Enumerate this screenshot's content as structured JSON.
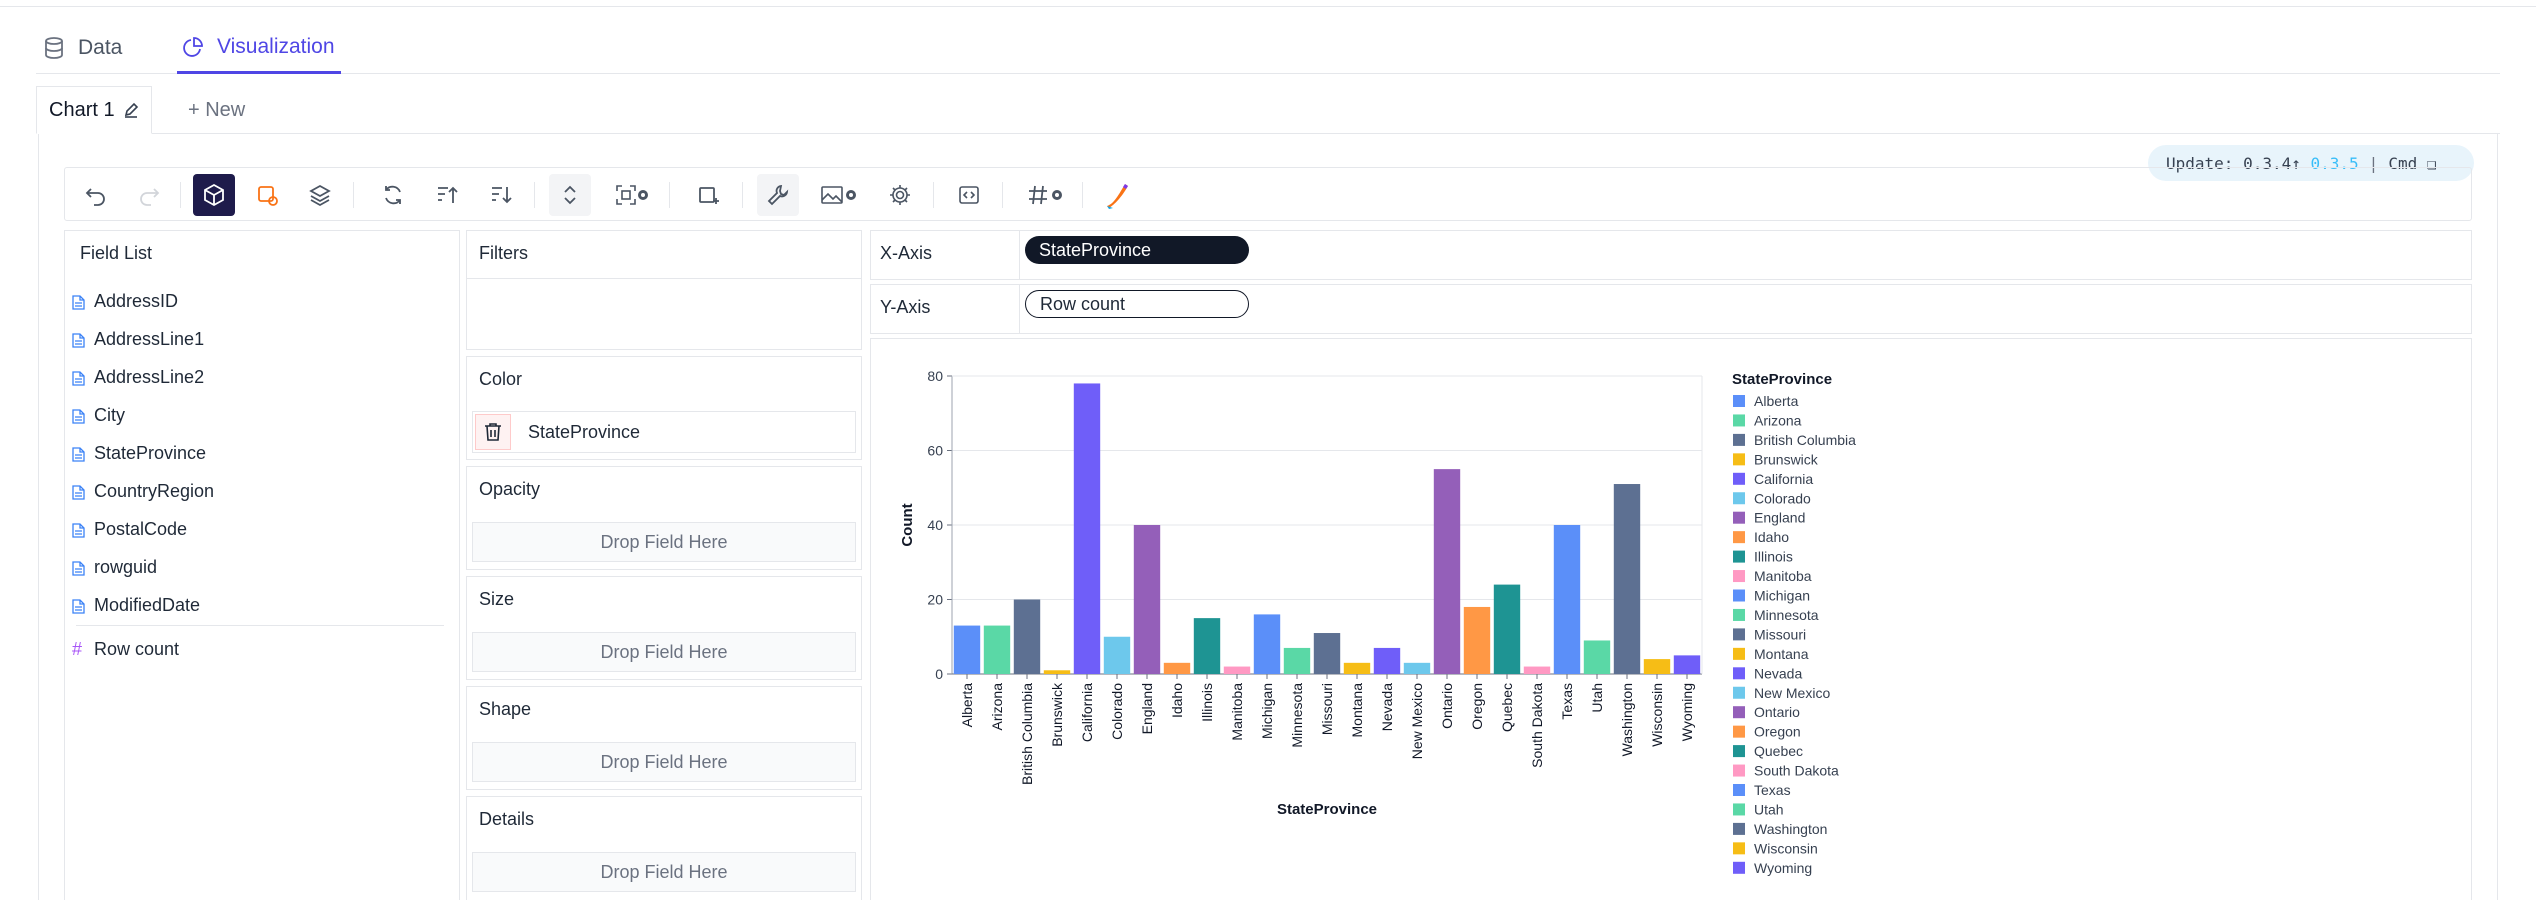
{
  "tabs": {
    "data": "Data",
    "visualization": "Visualization"
  },
  "chart_tabs": {
    "active": "Chart 1",
    "new": "+ New"
  },
  "update_badge": {
    "text": "Update: 0.3.4↑",
    "version": "0.3.5",
    "sep": "|",
    "cmd": "Cmd ❏"
  },
  "field_list": {
    "title": "Field List",
    "fields": [
      "AddressID",
      "AddressLine1",
      "AddressLine2",
      "City",
      "StateProvince",
      "CountryRegion",
      "PostalCode",
      "rowguid",
      "ModifiedDate"
    ],
    "measure": "Row count"
  },
  "encodings": {
    "filters": "Filters",
    "color": "Color",
    "color_field": "StateProvince",
    "opacity": "Opacity",
    "size": "Size",
    "shape": "Shape",
    "details": "Details",
    "drop_hint": "Drop Field Here"
  },
  "axes": {
    "x_label": "X-Axis",
    "x_field": "StateProvince",
    "y_label": "Y-Axis",
    "y_field": "Row count"
  },
  "colors": {
    "accent": "#4f46e5",
    "dark_toolbar": "#1e1b4b",
    "palette": [
      "#5B8FF9",
      "#5AD8A6",
      "#5D7092",
      "#F6BD16",
      "#6F5EF9",
      "#6DC8EC",
      "#945FB9",
      "#FF9845",
      "#1E9493",
      "#FF99C3"
    ]
  },
  "chart_data": {
    "type": "bar",
    "xlabel": "StateProvince",
    "ylabel": "Count",
    "ylim": [
      0,
      80
    ],
    "yticks": [
      0,
      20,
      40,
      60,
      80
    ],
    "legend_title": "StateProvince",
    "legend_position": "right",
    "grid": true,
    "categories": [
      "Alberta",
      "Arizona",
      "British Columbia",
      "Brunswick",
      "California",
      "Colorado",
      "England",
      "Idaho",
      "Illinois",
      "Manitoba",
      "Michigan",
      "Minnesota",
      "Missouri",
      "Montana",
      "Nevada",
      "New Mexico",
      "Ontario",
      "Oregon",
      "Quebec",
      "South Dakota",
      "Texas",
      "Utah",
      "Washington",
      "Wisconsin",
      "Wyoming"
    ],
    "values": [
      13,
      13,
      20,
      1,
      78,
      10,
      40,
      3,
      15,
      2,
      16,
      7,
      11,
      3,
      7,
      3,
      55,
      18,
      24,
      2,
      40,
      9,
      51,
      4,
      5
    ]
  }
}
